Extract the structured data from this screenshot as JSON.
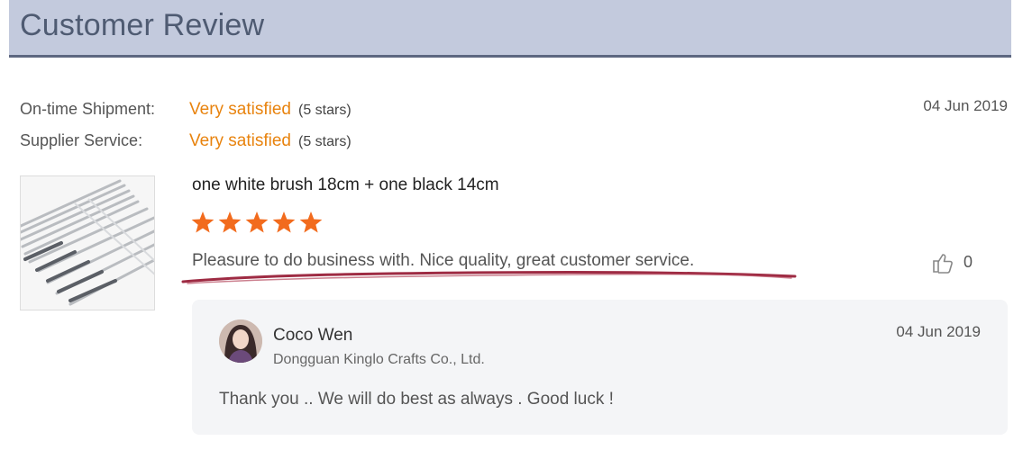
{
  "header": {
    "title": "Customer Review"
  },
  "ratings": [
    {
      "label": "On-time Shipment:",
      "value": "Very satisfied",
      "stars_note": "(5 stars)"
    },
    {
      "label": "Supplier Service:",
      "value": "Very satisfied",
      "stars_note": "(5 stars)"
    }
  ],
  "review": {
    "date": "04 Jun 2019",
    "product_title": "one white brush 18cm + one black 14cm",
    "rating": 5,
    "rating_max": 5,
    "text": "Pleasure to do business with. Nice quality, great customer service.",
    "like_count": "0",
    "star_color": "#f26b1d",
    "accent_color": "#e8830e"
  },
  "reply": {
    "name": "Coco Wen",
    "company": "Dongguan Kinglo Crafts Co., Ltd.",
    "date": "04 Jun 2019",
    "text": "Thank you .. We will do best as always . Good luck !"
  }
}
